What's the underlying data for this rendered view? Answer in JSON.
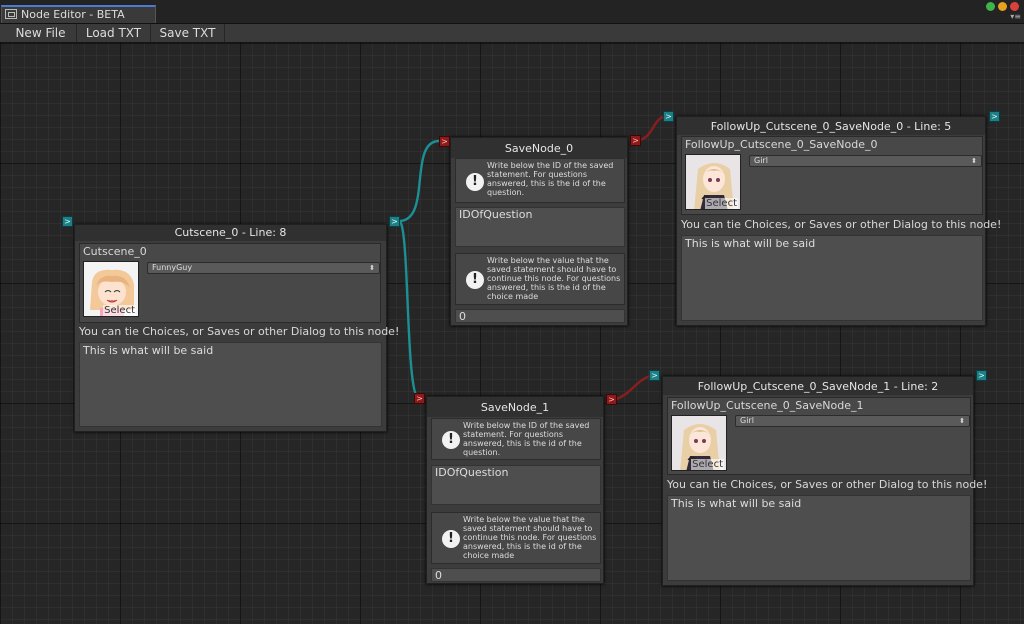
{
  "window": {
    "title": "Node Editor - BETA"
  },
  "toolbar": {
    "new_file": "New File",
    "load_txt": "Load TXT",
    "save_txt": "Save TXT"
  },
  "colors": {
    "wire_cyan": "#1c8f95",
    "wire_red": "#8a1e1e",
    "accent_tab": "#4b7ad1"
  },
  "cutscene_node": {
    "title": "Cutscene_0 - Line: 8",
    "name_field": "Cutscene_0",
    "character": "FunnyGuy",
    "select_label": "Select",
    "hint": "You can tie Choices, or Saves or other Dialog to this node!",
    "dialog": "This is what will be said"
  },
  "save_node_0": {
    "title": "SaveNode_0",
    "info_id": "Write below the ID of the saved statement. For questions answered, this is the id of the question.",
    "id_field": "IDOfQuestion",
    "info_value": "Write below the value that the saved statement should have to continue this node. For questions answered, this is the id of the choice made",
    "value_field": "0"
  },
  "save_node_1": {
    "title": "SaveNode_1",
    "info_id": "Write below the ID of the saved statement. For questions answered, this is the id of the question.",
    "id_field": "IDOfQuestion",
    "info_value": "Write below the value that the saved statement should have to continue this node. For questions answered, this is the id of the choice made",
    "value_field": "0"
  },
  "followup_0": {
    "title": "FollowUp_Cutscene_0_SaveNode_0 - Line: 5",
    "name_field": "FollowUp_Cutscene_0_SaveNode_0",
    "character": "Girl",
    "select_label": "Select",
    "hint": "You can tie Choices, or Saves or other Dialog to this node!",
    "dialog": "This is what will be said"
  },
  "followup_1": {
    "title": "FollowUp_Cutscene_0_SaveNode_1 - Line: 2",
    "name_field": "FollowUp_Cutscene_0_SaveNode_1",
    "character": "Girl",
    "select_label": "Select",
    "hint": "You can tie Choices, or Saves or other Dialog to this node!",
    "dialog": "This is what will be said"
  },
  "ports": {
    "in_glyph": ">",
    "out_glyph": ">"
  },
  "icons": {
    "info": "exclamation-icon",
    "dropdown": "updown-arrows-icon"
  },
  "dropdown_arrows": "⬍",
  "info_glyph": "!"
}
